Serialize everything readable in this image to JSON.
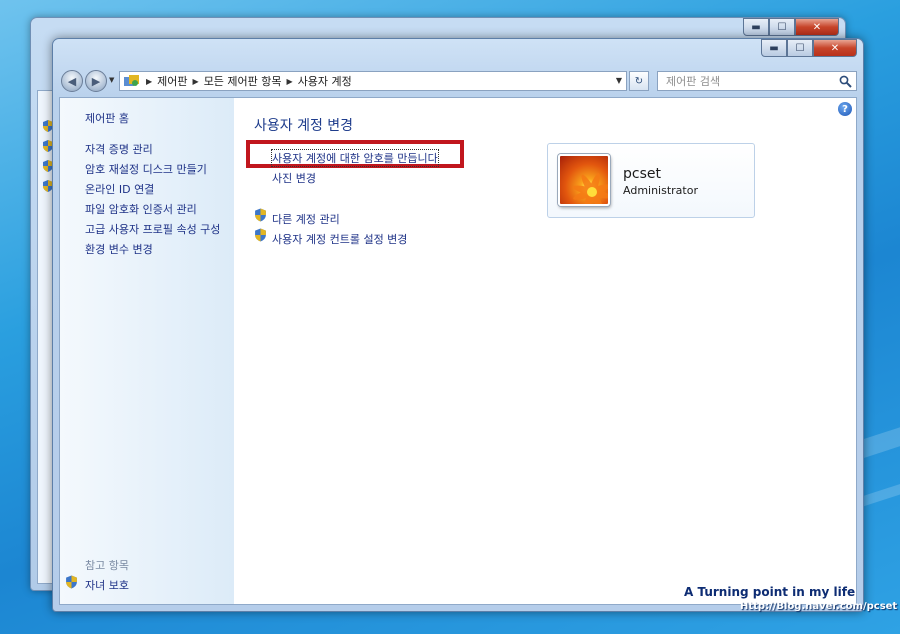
{
  "address_bar": {
    "breadcrumbs": [
      "제어판",
      "모든 제어판 항목",
      "사용자 계정"
    ]
  },
  "search": {
    "placeholder": "제어판 검색"
  },
  "sidebar": {
    "home": "제어판 홈",
    "links": [
      "자격 증명 관리",
      "암호 재설정 디스크 만들기",
      "온라인 ID 연결",
      "파일 암호화 인증서 관리",
      "고급 사용자 프로필 속성 구성",
      "환경 변수 변경"
    ],
    "see_also_heading": "참고 항목",
    "see_also_links": [
      "자녀 보호"
    ]
  },
  "main": {
    "title": "사용자 계정 변경",
    "tasks": [
      "사용자 계정에 대한 암호를 만듭니다",
      "사진 변경"
    ],
    "shield_tasks": [
      "다른 계정 관리",
      "사용자 계정 컨트롤 설정 변경"
    ]
  },
  "user": {
    "name": "pcset",
    "role": "Administrator"
  },
  "window_buttons": {
    "minimize": "▬",
    "maximize": "☐",
    "close": "✕"
  },
  "watermark": {
    "title": "A Turning point in my life",
    "url": "Http://Blog.naver.com/pcset"
  },
  "colors": {
    "highlight_box": "#c1161d",
    "link": "#1e3287"
  }
}
